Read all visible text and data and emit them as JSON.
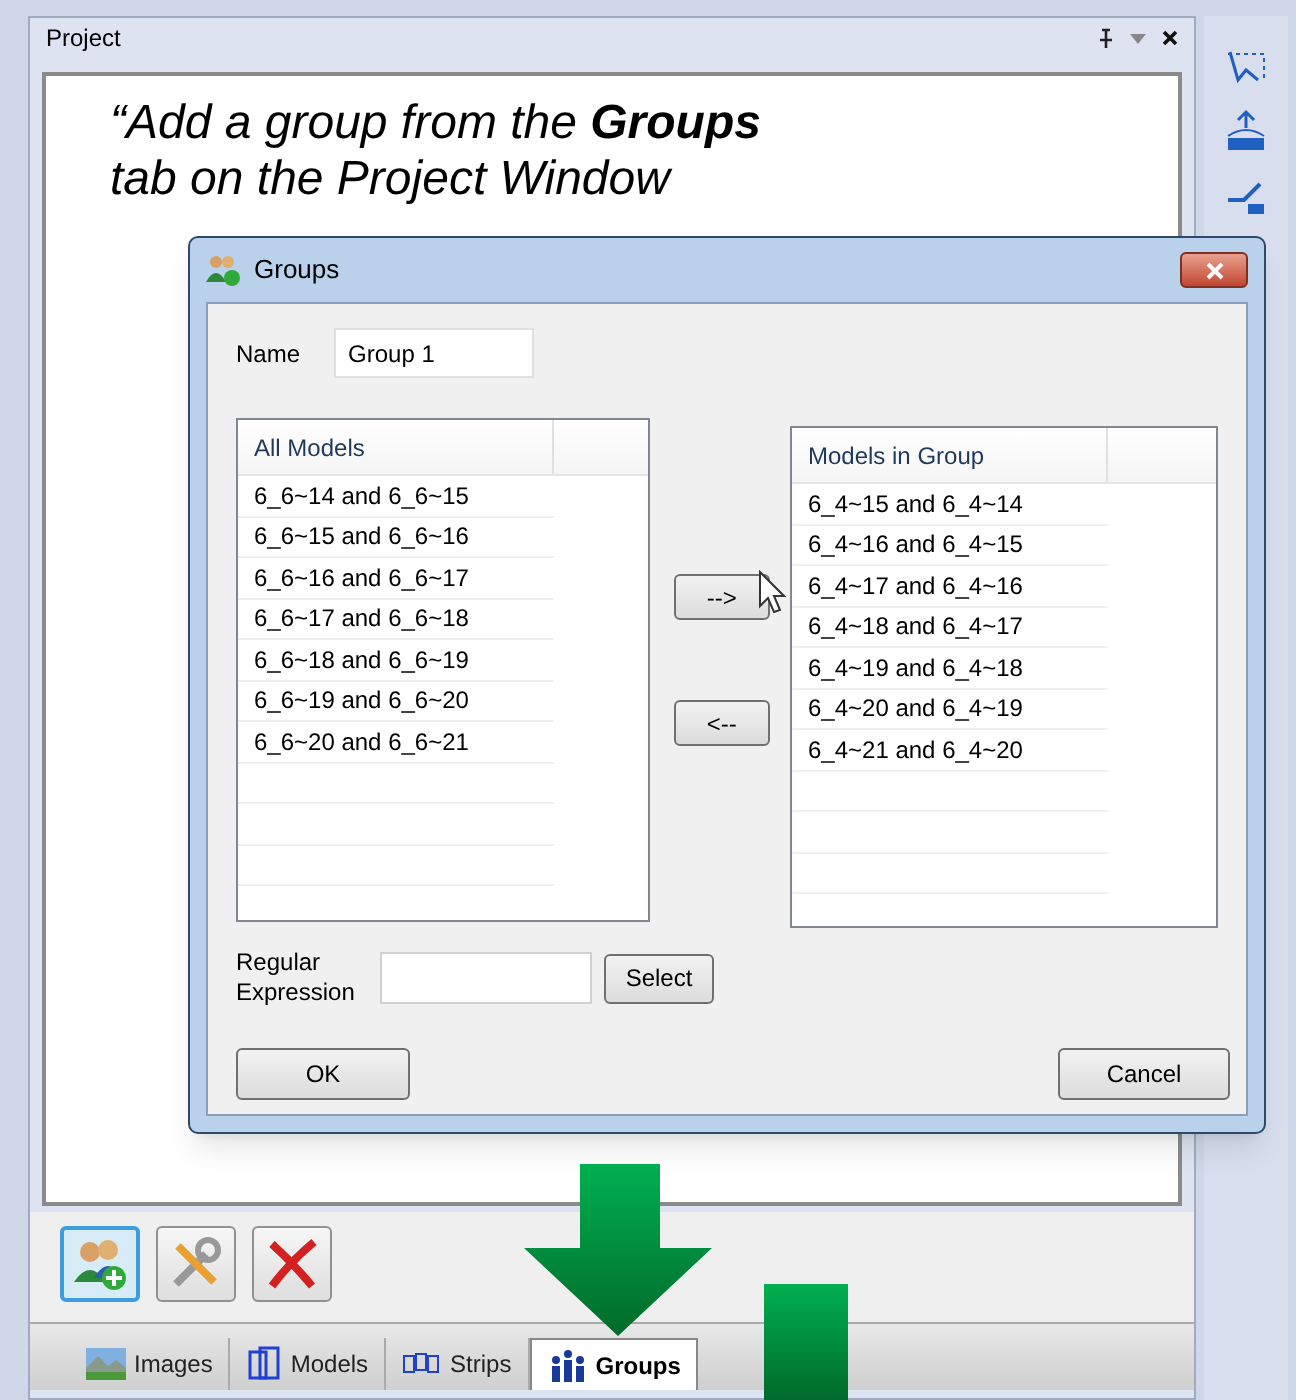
{
  "panel": {
    "title": "Project"
  },
  "caption_lines": [
    "“Add a group from the **Groups**",
    "tab on the Project Window"
  ],
  "tool_buttons": [
    {
      "kind": "add-group",
      "selected": true
    },
    {
      "kind": "tools",
      "selected": false
    },
    {
      "kind": "delete",
      "selected": false
    }
  ],
  "tabs": [
    {
      "label": "Images",
      "kind": "images",
      "selected": false
    },
    {
      "label": "Models",
      "kind": "models",
      "selected": false
    },
    {
      "label": "Strips",
      "kind": "strips",
      "selected": false
    },
    {
      "label": "Groups",
      "kind": "groups",
      "selected": true
    }
  ],
  "dialog": {
    "title": "Groups",
    "name_label": "Name",
    "name_value": "Group 1",
    "all_models": {
      "header": "All Models",
      "rows": [
        "6_6~14 and 6_6~15",
        "6_6~15 and 6_6~16",
        "6_6~16 and 6_6~17",
        "6_6~17 and 6_6~18",
        "6_6~18 and 6_6~19",
        "6_6~19 and 6_6~20",
        "6_6~20 and 6_6~21"
      ]
    },
    "models_in_group": {
      "header": "Models in Group",
      "rows": [
        "6_4~15 and 6_4~14",
        "6_4~16 and 6_4~15",
        "6_4~17 and 6_4~16",
        "6_4~18 and 6_4~17",
        "6_4~19 and 6_4~18",
        "6_4~20 and 6_4~19",
        "6_4~21 and 6_4~20"
      ]
    },
    "add_button": "-->",
    "remove_button": "<--",
    "regex_label": "Regular Expression",
    "select_button": "Select",
    "ok_button": "OK",
    "cancel_button": "Cancel"
  }
}
